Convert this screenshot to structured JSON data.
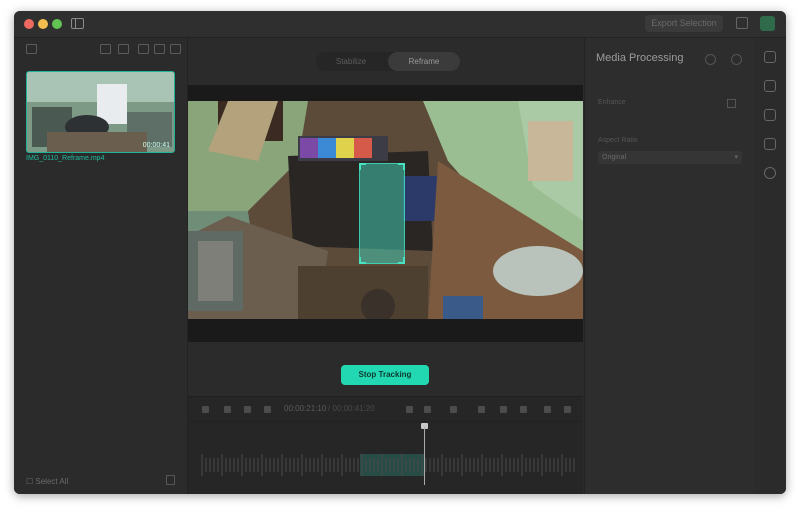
{
  "titlebar": {
    "export_label": "Export Selection"
  },
  "left_panel": {
    "clip_name": "IMG_0110_Reframe.mp4",
    "clip_duration": "00:00:41",
    "select_all_label": "☐ Select All"
  },
  "center": {
    "tabs": [
      {
        "label": "Stabilize",
        "active": false
      },
      {
        "label": "Reframe",
        "active": true
      }
    ],
    "stop_tracking_label": "Stop Tracking",
    "timeline": {
      "current_time": "00:00:21:10",
      "total_time": "/ 00:00:41:20"
    }
  },
  "right_panel": {
    "title": "Media Processing",
    "field1_label": "Enhance",
    "field2_label": "Aspect Ratio",
    "field2_value": "Original"
  },
  "colors": {
    "accent": "#22d8b2",
    "tracking_box": "#40c8af"
  }
}
